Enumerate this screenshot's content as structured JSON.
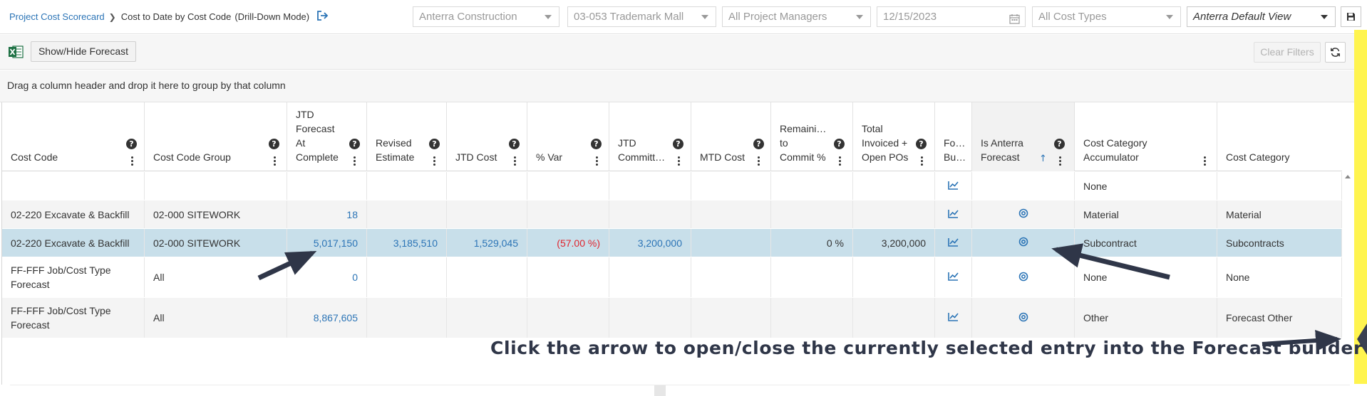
{
  "breadcrumb": {
    "parent": "Project Cost Scorecard",
    "current": "Cost to Date by Cost Code",
    "mode": "(Drill-Down Mode)"
  },
  "filters": {
    "company": "Anterra Construction",
    "project": "03-053 Trademark Mall",
    "managers": "All Project Managers",
    "date": "12/15/2023",
    "cost_types": "All Cost Types",
    "view": "Anterra Default View"
  },
  "toolbar": {
    "show_hide_forecast": "Show/Hide Forecast",
    "clear_filters": "Clear Filters"
  },
  "group_panel": {
    "hint": "Drag a column header and drop it here to group by that column"
  },
  "grid": {
    "columns": [
      {
        "label": "Cost Code"
      },
      {
        "label": "Cost Code Group"
      },
      {
        "label": "JTD\nForecast\nAt\nComplete"
      },
      {
        "label": "Revised\nEstimate"
      },
      {
        "label": "JTD Cost"
      },
      {
        "label": "% Var"
      },
      {
        "label": "JTD\nCommitt…"
      },
      {
        "label": "MTD Cost"
      },
      {
        "label": "Remaini…\nto\nCommit %"
      },
      {
        "label": "Total\nInvoiced +\nOpen POs"
      },
      {
        "label": "Fo…\nBu…"
      },
      {
        "label": "Is Anterra\nForecast"
      },
      {
        "label": "Cost Category\nAccumulator"
      },
      {
        "label": "Cost Category"
      }
    ],
    "rows": [
      {
        "cost_code": "",
        "group": "",
        "forecast": "",
        "revised": "",
        "jtd_cost": "",
        "var": "",
        "committed": "",
        "mtd": "",
        "remaining": "",
        "invoiced": "",
        "accumulator": "None",
        "category": ""
      },
      {
        "cost_code": "02-220 Excavate & Backfill",
        "group": "02-000 SITEWORK",
        "forecast": "18",
        "revised": "",
        "jtd_cost": "",
        "var": "",
        "committed": "",
        "mtd": "",
        "remaining": "",
        "invoiced": "",
        "accumulator": "Material",
        "category": "Material"
      },
      {
        "cost_code": "02-220 Excavate & Backfill",
        "group": "02-000 SITEWORK",
        "forecast": "5,017,150",
        "revised": "3,185,510",
        "jtd_cost": "1,529,045",
        "var": "(57.00 %)",
        "committed": "3,200,000",
        "mtd": "",
        "remaining": "0 %",
        "invoiced": "3,200,000",
        "accumulator": "Subcontract",
        "category": "Subcontracts"
      },
      {
        "cost_code": "FF-FFF Job/Cost Type Forecast",
        "group": "All",
        "forecast": "0",
        "revised": "",
        "jtd_cost": "",
        "var": "",
        "committed": "",
        "mtd": "",
        "remaining": "",
        "invoiced": "",
        "accumulator": "None",
        "category": "None"
      },
      {
        "cost_code": "FF-FFF Job/Cost Type Forecast",
        "group": "All",
        "forecast": "8,867,605",
        "revised": "",
        "jtd_cost": "",
        "var": "",
        "committed": "",
        "mtd": "",
        "remaining": "",
        "invoiced": "",
        "accumulator": "Other",
        "category": "Forecast Other"
      }
    ]
  },
  "annotation": {
    "callout": "Click the arrow to open/close the currently selected entry into the Forecast builder"
  },
  "colors": {
    "link_blue": "#2b74b6",
    "negative_red": "#e0242e",
    "selected_row": "#c8dfea",
    "highlight_yellow": "#fff44f",
    "annotation_navy": "#2f3648"
  },
  "icons": [
    "exit-icon",
    "calendar-icon",
    "save-icon",
    "excel-icon",
    "refresh-icon",
    "help-icon",
    "column-menu-icon",
    "sort-asc-icon",
    "forecast-chart-icon",
    "forecast-target-icon"
  ]
}
